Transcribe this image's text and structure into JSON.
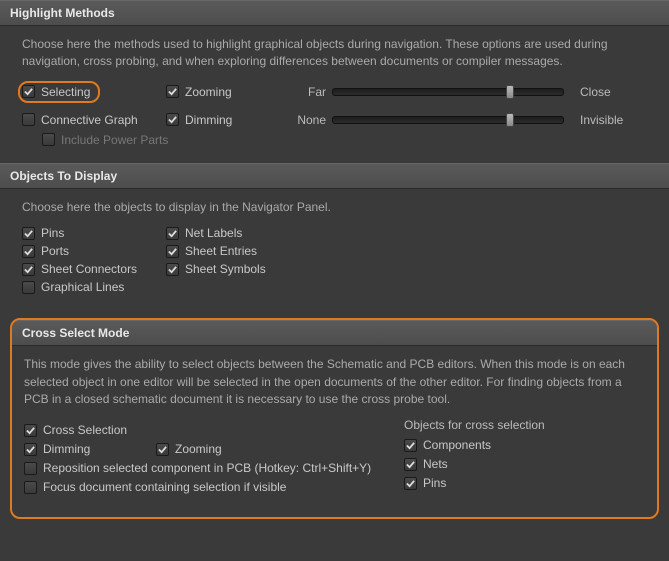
{
  "highlight": {
    "title": "Highlight Methods",
    "desc": "Choose here the methods used to highlight graphical objects during navigation. These options are used during navigation, cross probing, and when exploring differences between documents or compiler messages.",
    "selecting": "Selecting",
    "zooming": "Zooming",
    "connective": "Connective Graph",
    "dimming": "Dimming",
    "includePower": "Include Power Parts",
    "slider1": {
      "left": "Far",
      "right": "Close"
    },
    "slider2": {
      "left": "None",
      "right": "Invisible"
    }
  },
  "objects": {
    "title": "Objects To Display",
    "desc": "Choose here the objects to display in the Navigator Panel.",
    "pins": "Pins",
    "netLabels": "Net Labels",
    "ports": "Ports",
    "sheetEntries": "Sheet Entries",
    "sheetConnectors": "Sheet Connectors",
    "sheetSymbols": "Sheet Symbols",
    "graphicalLines": "Graphical Lines"
  },
  "cross": {
    "title": "Cross Select Mode",
    "desc": "This mode gives the ability to select objects between the Schematic and PCB editors.  When this mode is on each selected object in one editor will be selected in the open documents of the other editor.  For finding objects from a PCB in a closed schematic document it is necessary to use the cross probe tool.",
    "crossSelection": "Cross Selection",
    "dimming": "Dimming",
    "zooming": "Zooming",
    "reposition": "Reposition selected component in PCB (Hotkey: Ctrl+Shift+Y)",
    "focus": "Focus document containing selection if visible",
    "objectsHeader": "Objects for cross selection",
    "components": "Components",
    "nets": "Nets",
    "pins": "Pins"
  }
}
